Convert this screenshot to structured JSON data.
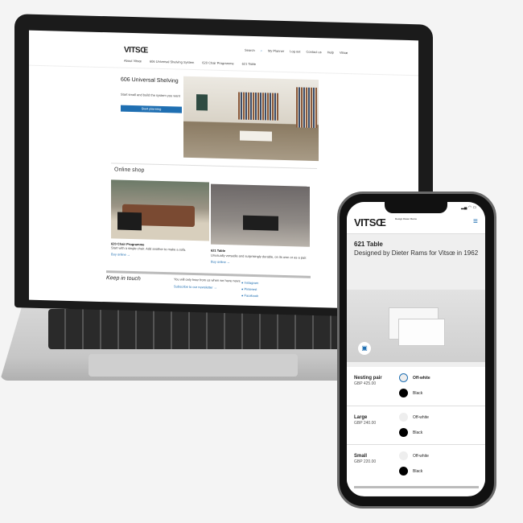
{
  "laptop": {
    "header": {
      "logo": "VITSŒ",
      "utility": [
        "Search",
        "My Planner",
        "Log out",
        "Contact us",
        "Help",
        "Vitsœ"
      ],
      "nav": [
        "About Vitsœ",
        "606 Universal Shelving System",
        "620 Chair Programme",
        "621 Table"
      ]
    },
    "hero": {
      "title": "606 Universal Shelving",
      "text": "Start small and build the system you want",
      "button": "Start planning"
    },
    "shop": {
      "title": "Online shop",
      "products": [
        {
          "name": "620 Chair Programme",
          "desc": "Start with a single chair. Add another to make a sofa.",
          "link": "Buy online"
        },
        {
          "name": "621 Table",
          "desc": "Unusually versatile and surprisingly durable, on its own or as a pair.",
          "link": "Buy online"
        }
      ]
    },
    "footer": {
      "title": "Keep in touch",
      "text": "You will only hear from us when we have news",
      "link": "Subscribe to our newsletter",
      "social": [
        "Instagram",
        "Pinterest",
        "Facebook"
      ]
    }
  },
  "phone": {
    "logo": "VITSŒ",
    "tagline": "Design Dieter Rams",
    "title": "621 Table",
    "subtitle": "Designed by Dieter Rams for Vitsœ in 1962",
    "accent": "#1f6fb2",
    "options": [
      {
        "name": "Nesting pair",
        "price": "GBP 425.00",
        "colours": [
          "Off-white",
          "Black"
        ],
        "selected": "Off-white"
      },
      {
        "name": "Large",
        "price": "GBP 240.00",
        "colours": [
          "Off-white",
          "Black"
        ]
      },
      {
        "name": "Small",
        "price": "GBP 220.00",
        "colours": [
          "Off-white",
          "Black"
        ]
      }
    ]
  }
}
